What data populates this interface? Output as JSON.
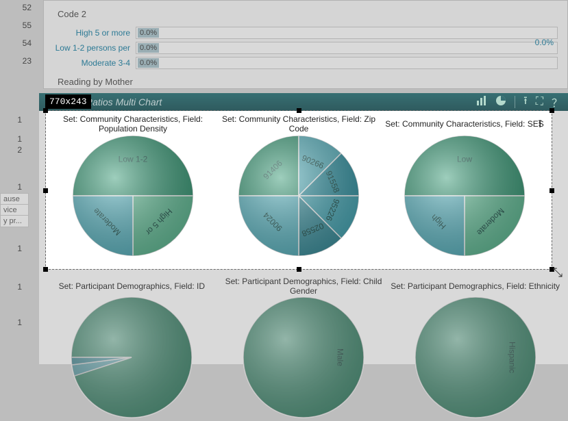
{
  "top": {
    "code_label": "Code 2",
    "rows": [
      {
        "label": "High 5 or more",
        "pct": "0.0%"
      },
      {
        "label": "Low 1-2 persons per",
        "pct": "0.0%"
      },
      {
        "label": "Moderate 3-4",
        "pct": "0.0%"
      }
    ],
    "total_pct": "0.0%",
    "reading_label": "Reading by Mother"
  },
  "left_fragments": {
    "nums_top": [
      "52",
      "55",
      "54",
      "23"
    ],
    "ones": [
      "1",
      "1",
      "2",
      "1",
      "1",
      "1",
      "1"
    ],
    "frag_text": [
      "ause",
      "vice",
      "y pr..."
    ]
  },
  "chart_panel": {
    "title": "Ratios Multi Chart",
    "dim_badge": "770x243"
  },
  "chart_data": [
    {
      "type": "pie",
      "title": "Set: Community Characteristics, Field: Population Density",
      "series": [
        {
          "name": "Low 1-2",
          "value": 50
        },
        {
          "name": "High 5 or",
          "value": 25
        },
        {
          "name": "Moderate",
          "value": 25
        }
      ]
    },
    {
      "type": "pie",
      "title": "Set: Community Characteristics, Field: Zip Code",
      "series": [
        {
          "name": "91406",
          "value": 25
        },
        {
          "name": "90266",
          "value": 12.5
        },
        {
          "name": "91558",
          "value": 12.5
        },
        {
          "name": "95226",
          "value": 12.5
        },
        {
          "name": "02558",
          "value": 12.5
        },
        {
          "name": "90024",
          "value": 25
        }
      ]
    },
    {
      "type": "pie",
      "title": "Set: Community Characteristics, Field: SES",
      "series": [
        {
          "name": "Low",
          "value": 50
        },
        {
          "name": "Moderate",
          "value": 25
        },
        {
          "name": "High",
          "value": 25
        }
      ]
    },
    {
      "type": "pie",
      "title": "Set: Participant Demographics, Field: ID",
      "series": [
        {
          "name": "slice",
          "value": 95
        },
        {
          "name": "slice",
          "value": 3
        },
        {
          "name": "slice",
          "value": 2
        }
      ]
    },
    {
      "type": "pie",
      "title": "Set: Participant Demographics, Field: Child Gender",
      "series": [
        {
          "name": "Male",
          "value": 100
        }
      ]
    },
    {
      "type": "pie",
      "title": "Set: Participant Demographics, Field: Ethnicity",
      "series": [
        {
          "name": "Hispanic",
          "value": 100
        }
      ]
    }
  ],
  "colors": {
    "green_dark": "#3d9d7a",
    "green_light": "#66c09a",
    "teal_dark": "#3a99a8",
    "teal_light": "#5cb6c2"
  }
}
